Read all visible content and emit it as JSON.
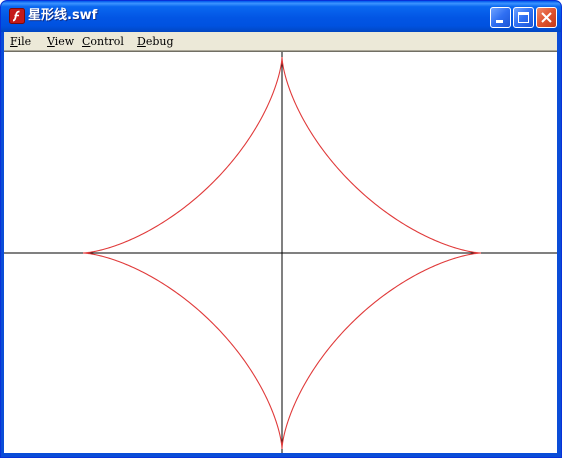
{
  "window": {
    "title": "星形线.swf"
  },
  "icons": {
    "app": "flash-player-icon",
    "minimize": "minimize-icon",
    "maximize": "maximize-icon",
    "close": "close-icon"
  },
  "menu": {
    "file_first": "F",
    "file_rest": "ile",
    "view_first": "V",
    "view_rest": "iew",
    "control_first": "C",
    "control_rest": "ontrol",
    "debug_first": "D",
    "debug_rest": "ebug"
  },
  "colors": {
    "curve": "#e03a3a",
    "axes": "#000000",
    "titlebar": "#0055e5",
    "menubar": "#ece9d8"
  },
  "stage": {
    "shape": "astroid",
    "curve_color": "#e03a3a",
    "axis_color": "#000000"
  }
}
